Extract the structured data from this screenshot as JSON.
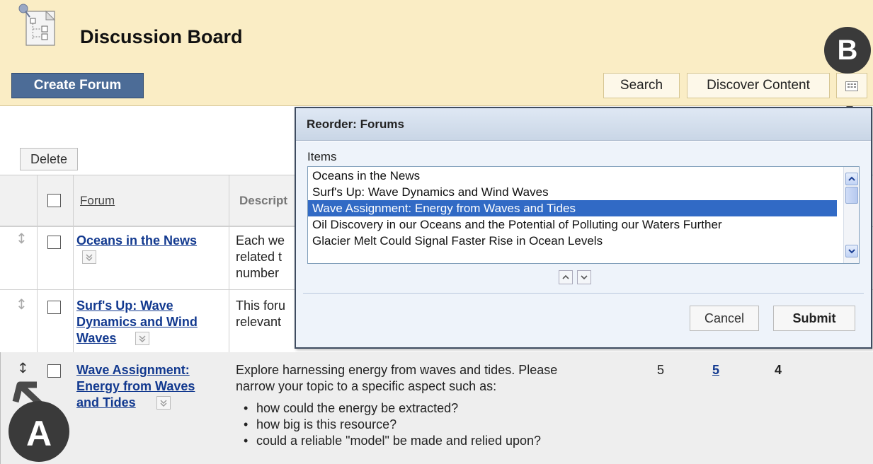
{
  "header": {
    "title": "Discussion Board",
    "create_label": "Create Forum",
    "search_label": "Search",
    "discover_label": "Discover Content"
  },
  "markers": {
    "a": "A",
    "b": "B"
  },
  "toolbar": {
    "delete_label": "Delete"
  },
  "columns": {
    "forum": "Forum",
    "description": "Descript"
  },
  "rows": [
    {
      "forum_lines": [
        "Oceans in the News"
      ],
      "desc_lines": [
        "Each we",
        "related t",
        "number"
      ]
    },
    {
      "forum_lines": [
        "Surf's Up: Wave",
        "Dynamics and Wind",
        "Waves"
      ],
      "desc_lines": [
        "This foru",
        "relevant"
      ]
    },
    {
      "forum_lines": [
        "Wave Assignment:",
        "Energy from Waves",
        "and Tides"
      ],
      "desc_lines": [
        "Explore harnessing energy from waves and tides. Please",
        "narrow your topic to a specific aspect such as:"
      ],
      "bullets": [
        "how could the energy be extracted?",
        "how big is this resource?",
        "could a reliable \"model\" be made and relied upon?"
      ],
      "total_posts": "5",
      "unread_posts": "5",
      "participants": "4"
    }
  ],
  "popup": {
    "title": "Reorder: Forums",
    "items_label": "Items",
    "items": [
      "Oceans in the News",
      "Surf's Up: Wave Dynamics and Wind Waves",
      "Wave Assignment: Energy from Waves and Tides",
      "Oil Discovery in our Oceans and the Potential of Polluting our Waters Further",
      "Glacier Melt Could Signal Faster Rise in Ocean Levels"
    ],
    "selected_index": 2,
    "cancel_label": "Cancel",
    "submit_label": "Submit"
  },
  "colors": {
    "header_bg": "#faedc5",
    "create_button": "#4c6c97",
    "link": "#12398f",
    "selection": "#316ac5",
    "marker": "#3a3a3a"
  }
}
